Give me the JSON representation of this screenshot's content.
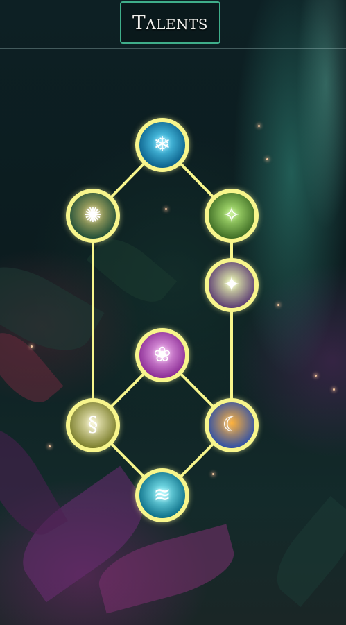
{
  "header": {
    "title": "Talents"
  },
  "talents": [
    {
      "id": "frost",
      "icon": "snowflake-icon",
      "glyph": "❄",
      "colors": [
        "#5fe0ff",
        "#0a5f8a"
      ]
    },
    {
      "id": "mandala",
      "icon": "mandala-icon",
      "glyph": "✺",
      "colors": [
        "#d8c670",
        "#1e4d37"
      ]
    },
    {
      "id": "forest-dancer",
      "icon": "dancer-icon",
      "glyph": "✧",
      "colors": [
        "#b7ef7a",
        "#3d6b24"
      ]
    },
    {
      "id": "light-dancer",
      "icon": "dancer-glow-icon",
      "glyph": "✦",
      "colors": [
        "#f0ffb0",
        "#5a3a72"
      ]
    },
    {
      "id": "lotus",
      "icon": "lotus-icon",
      "glyph": "❀",
      "colors": [
        "#f3b1f0",
        "#8a2b94"
      ]
    },
    {
      "id": "serpent",
      "icon": "serpent-icon",
      "glyph": "§",
      "colors": [
        "#f7f3c8",
        "#7a7d2a"
      ]
    },
    {
      "id": "sun-moon",
      "icon": "sun-moon-icon",
      "glyph": "☾",
      "colors": [
        "#ffb23a",
        "#2d4fa8"
      ]
    },
    {
      "id": "waterfall",
      "icon": "waterfall-icon",
      "glyph": "≋",
      "colors": [
        "#8ef8ff",
        "#0b6e87"
      ]
    }
  ]
}
